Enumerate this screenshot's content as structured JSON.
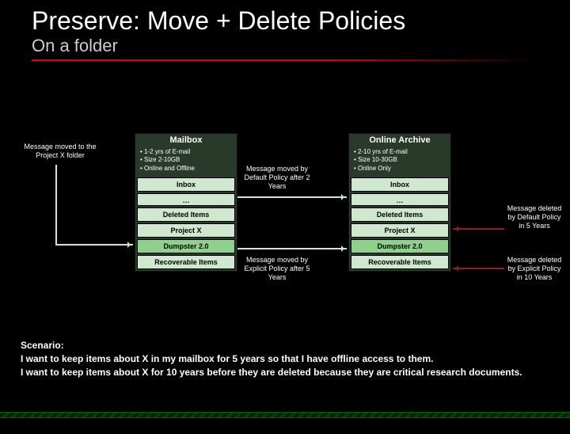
{
  "title": "Preserve: Move + Delete Policies",
  "subtitle": "On a folder",
  "callouts": {
    "move_folder": "Message moved to the Project X folder",
    "msg_move_default": "Message moved by Default Policy after 2 Years",
    "msg_move_explicit": "Message moved by Explicit Policy after 5 Years",
    "del_default": "Message deleted by Default Policy in 5 Years",
    "del_explicit": "Message deleted by Explicit Policy in 10 Years"
  },
  "mailbox": {
    "title": "Mailbox",
    "bullets": [
      "1-2 yrs of E-mail",
      "Size 2-10GB",
      "Online and Offline"
    ],
    "rows": {
      "inbox": "Inbox",
      "ellipsis": "…",
      "deleted": "Deleted Items",
      "projectx": "Project X",
      "dumpster": "Dumpster 2.0",
      "recoverable": "Recoverable Items"
    }
  },
  "archive": {
    "title": "Online Archive",
    "bullets": [
      "2-10 yrs of E-mail",
      "Size 10-30GB",
      "Online Only"
    ],
    "rows": {
      "inbox": "Inbox",
      "ellipsis": "…",
      "deleted": "Deleted Items",
      "projectx": "Project X",
      "dumpster": "Dumpster 2.0",
      "recoverable": "Recoverable Items"
    }
  },
  "scenario": {
    "heading": "Scenario:",
    "line1": "I want to keep items about X in my mailbox for 5 years so that I have offline access to them.",
    "line2": "I want to keep items about X for 10 years before they are deleted because they are critical research documents."
  }
}
